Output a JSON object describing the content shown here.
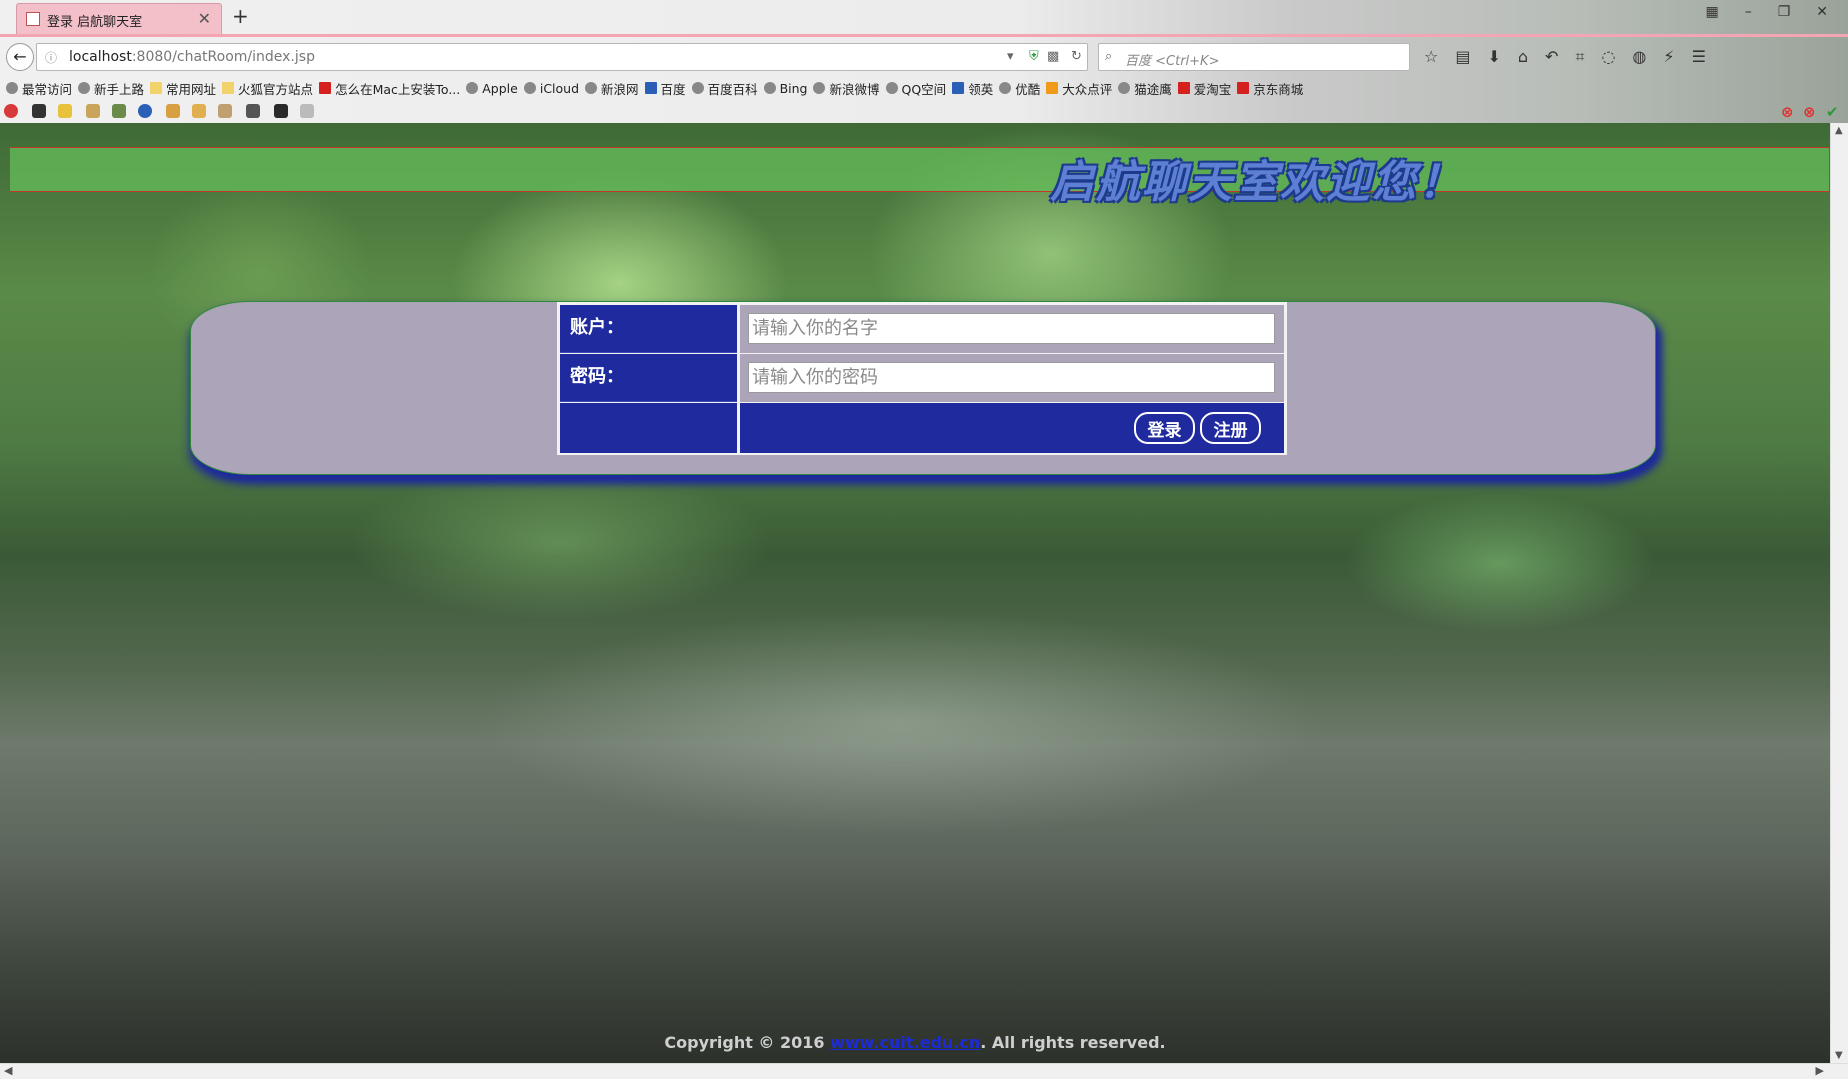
{
  "browser": {
    "tab_title": "登录 启航聊天室",
    "url_host": "localhost",
    "url_path": ":8080/chatRoom/index.jsp",
    "search_placeholder": "百度 <Ctrl+K>",
    "tab_bar_color": "#f3bfc9",
    "bookmarks": [
      {
        "label": "最常访问",
        "icon": "globe-icon"
      },
      {
        "label": "新手上路",
        "icon": "globe-icon"
      },
      {
        "label": "常用网址",
        "icon": "folder-icon"
      },
      {
        "label": "火狐官方站点",
        "icon": "folder-icon"
      },
      {
        "label": "怎么在Mac上安装To...",
        "icon": "red-c-icon"
      },
      {
        "label": "Apple",
        "icon": "apple-icon"
      },
      {
        "label": "iCloud",
        "icon": "globe-icon"
      },
      {
        "label": "新浪网",
        "icon": "globe-icon"
      },
      {
        "label": "百度",
        "icon": "paw-icon"
      },
      {
        "label": "百度百科",
        "icon": "globe-icon"
      },
      {
        "label": "Bing",
        "icon": "globe-icon"
      },
      {
        "label": "新浪微博",
        "icon": "globe-icon"
      },
      {
        "label": "QQ空间",
        "icon": "globe-icon"
      },
      {
        "label": "领英",
        "icon": "linkedin-icon"
      },
      {
        "label": "优酷",
        "icon": "globe-icon"
      },
      {
        "label": "大众点评",
        "icon": "star-icon"
      },
      {
        "label": "猫途鹰",
        "icon": "globe-icon"
      },
      {
        "label": "爱淘宝",
        "icon": "taobao-icon"
      },
      {
        "label": "京东商城",
        "icon": "jd-icon"
      }
    ]
  },
  "page": {
    "banner_text": "启航聊天室欢迎您！",
    "account_label": "账户：",
    "account_placeholder": "请输入你的名字",
    "password_label": "密码：",
    "password_placeholder": "请输入你的密码",
    "login_button": "登录",
    "register_button": "注册",
    "footer_prefix": "Copyright © 2016 ",
    "footer_link": "www.cuit.edu.cn",
    "footer_suffix": ". All rights reserved.",
    "accent_color": "#1f2a9e",
    "panel_color": "#aca4b8"
  }
}
